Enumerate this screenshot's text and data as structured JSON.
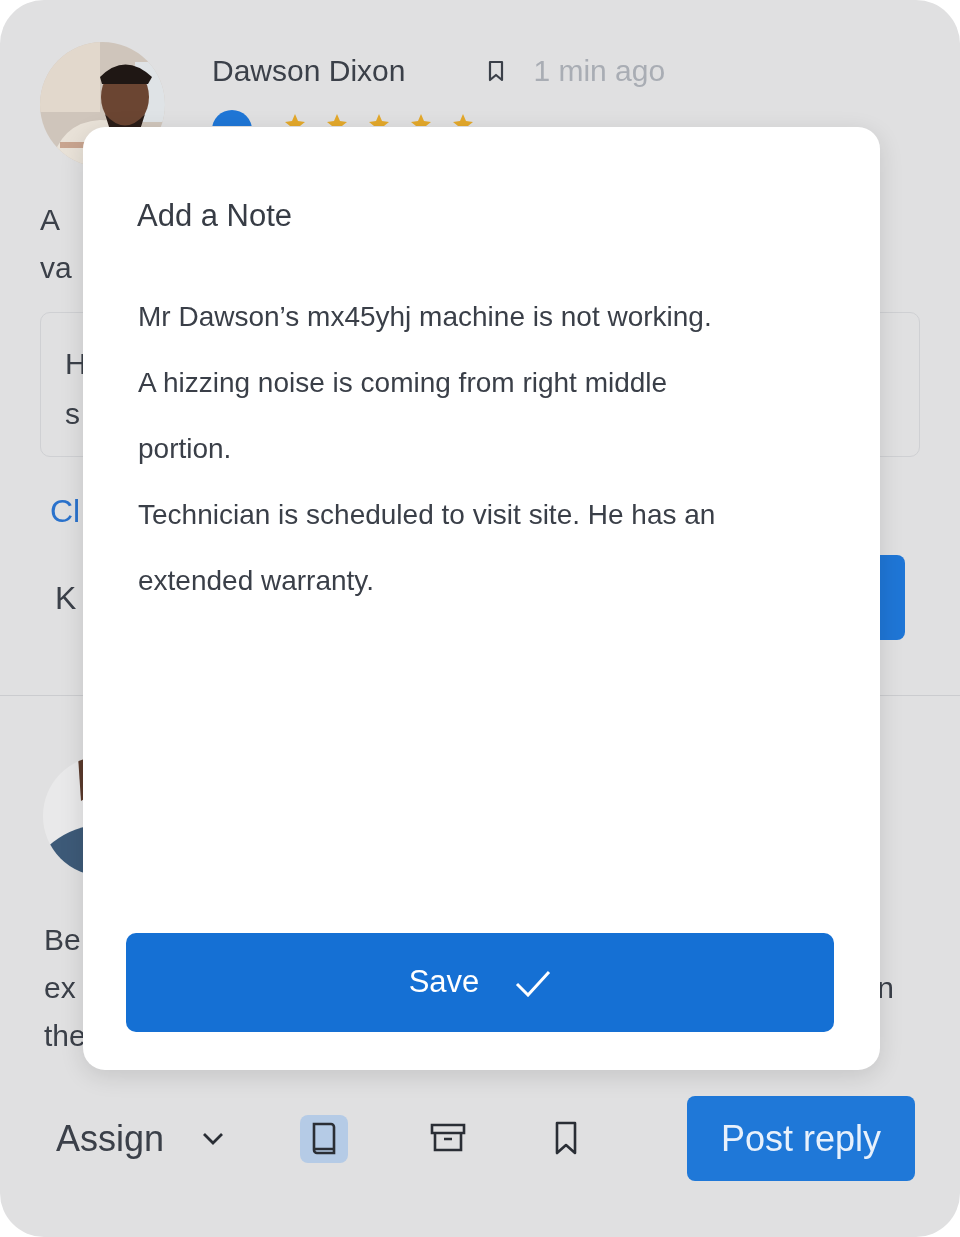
{
  "post": {
    "author": "Dawson Dixon",
    "time": "1 min ago",
    "stars": 5,
    "text_lines": [
      "A",
      "va"
    ],
    "quote_lines": [
      "H",
      "s"
    ],
    "link": "Cl",
    "input_text": "K"
  },
  "second_post": {
    "text_lines": [
      "Be",
      "ex",
      "the"
    ],
    "right_fragment": "n"
  },
  "modal": {
    "title": "Add a Note",
    "paragraphs": [
      "Mr Dawson’s mx45yhj machine is not working.",
      "A hizzing noise is coming from right middle portion.",
      "Technician is scheduled to visit site. He has an extended warranty."
    ],
    "button": "Save"
  },
  "toolbar": {
    "assign": "Assign",
    "tools": [
      {
        "kind": "book",
        "selected": true
      },
      {
        "kind": "archive",
        "selected": false
      },
      {
        "kind": "bookmark",
        "selected": false
      }
    ],
    "post_button": "Post reply"
  }
}
